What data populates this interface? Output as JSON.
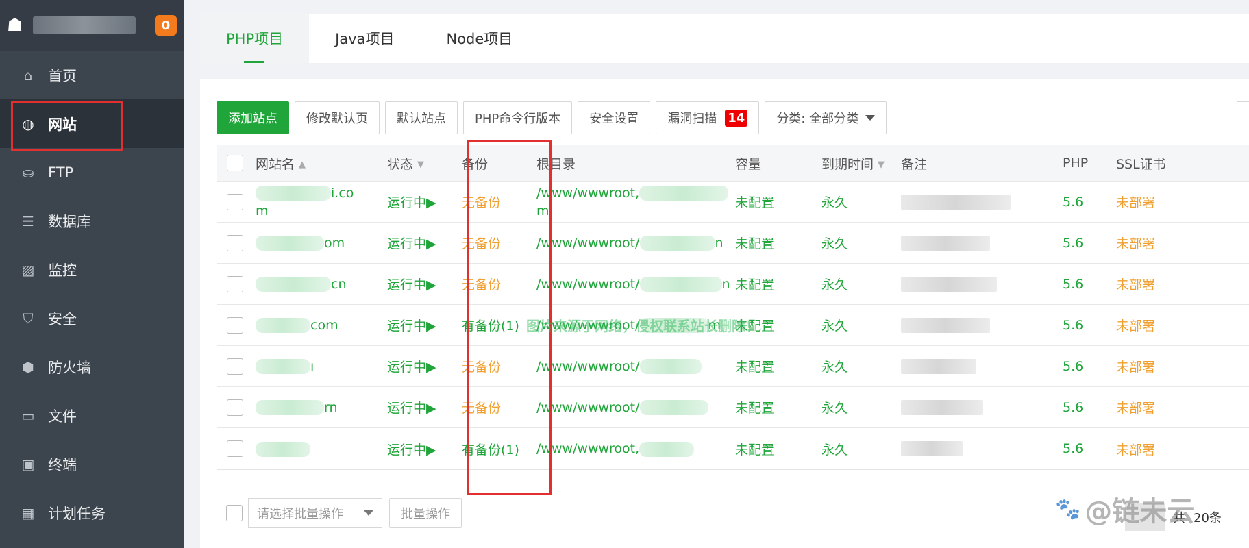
{
  "sidebar": {
    "badge": "0",
    "items": [
      {
        "icon": "home-icon",
        "glyph": "⌂",
        "label": "首页",
        "active": false
      },
      {
        "icon": "globe-icon",
        "glyph": "◍",
        "label": "网站",
        "active": true
      },
      {
        "icon": "ftp-icon",
        "glyph": "⛀",
        "label": "FTP",
        "active": false
      },
      {
        "icon": "database-icon",
        "glyph": "☰",
        "label": "数据库",
        "active": false
      },
      {
        "icon": "monitor-icon",
        "glyph": "▨",
        "label": "监控",
        "active": false
      },
      {
        "icon": "shield-icon",
        "glyph": "⛉",
        "label": "安全",
        "active": false
      },
      {
        "icon": "firewall-icon",
        "glyph": "⬢",
        "label": "防火墙",
        "active": false
      },
      {
        "icon": "folder-icon",
        "glyph": "▭",
        "label": "文件",
        "active": false
      },
      {
        "icon": "terminal-icon",
        "glyph": "▣",
        "label": "终端",
        "active": false
      },
      {
        "icon": "calendar-icon",
        "glyph": "▦",
        "label": "计划任务",
        "active": false
      }
    ]
  },
  "tabs": [
    "PHP项目",
    "Java项目",
    "Node项目"
  ],
  "toolbar": {
    "add_site": "添加站点",
    "edit_default_page": "修改默认页",
    "default_site": "默认站点",
    "php_cli_version": "PHP命令行版本",
    "security_settings": "安全设置",
    "vuln_scan": "漏洞扫描",
    "vuln_count": "14",
    "category": "分类: 全部分类"
  },
  "table": {
    "headers": {
      "name": "网站名",
      "status": "状态",
      "backup": "备份",
      "root": "根目录",
      "capacity": "容量",
      "expire": "到期时间",
      "note": "备注",
      "php": "PHP",
      "ssl": "SSL证书"
    },
    "rows": [
      {
        "name_tail": "i.co",
        "name_line2": "m",
        "status": "运行中▶",
        "backup": "无备份",
        "has_backup": false,
        "root": "/www/wwwroot,",
        "root_line2": "m",
        "capacity": "未配置",
        "expire": "永久",
        "php": "5.6",
        "ssl": "未部署"
      },
      {
        "name_tail": "om",
        "name_line2": "",
        "status": "运行中▶",
        "backup": "无备份",
        "has_backup": false,
        "root": "/www/wwwroot/",
        "root_tail": "n",
        "capacity": "未配置",
        "expire": "永久",
        "php": "5.6",
        "ssl": "未部署"
      },
      {
        "name_tail": "cn",
        "name_line2": "",
        "status": "运行中▶",
        "backup": "无备份",
        "has_backup": false,
        "root": "/www/wwwroot/",
        "root_tail": "n",
        "capacity": "未配置",
        "expire": "永久",
        "php": "5.6",
        "ssl": "未部署"
      },
      {
        "name_tail": "com",
        "name_line2": "",
        "status": "运行中▶",
        "backup": "有备份(1)",
        "has_backup": true,
        "root": "/www/wwwroot/",
        "root_tail": "m",
        "capacity": "未配置",
        "expire": "永久",
        "php": "5.6",
        "ssl": "未部署"
      },
      {
        "name_tail": "ı",
        "name_line2": "",
        "status": "运行中▶",
        "backup": "无备份",
        "has_backup": false,
        "root": "/www/wwwroot/",
        "root_tail": "",
        "capacity": "未配置",
        "expire": "永久",
        "php": "5.6",
        "ssl": "未部署"
      },
      {
        "name_tail": "rn",
        "name_line2": "",
        "status": "运行中▶",
        "backup": "无备份",
        "has_backup": false,
        "root": "/www/wwwroot/",
        "root_tail": "",
        "capacity": "未配置",
        "expire": "永久",
        "php": "5.6",
        "ssl": "未部署"
      },
      {
        "name_tail": "",
        "name_line2": "",
        "status": "运行中▶",
        "backup": "有备份(1)",
        "has_backup": true,
        "root": "/www/wwwroot,",
        "root_tail": "",
        "capacity": "未配置",
        "expire": "永久",
        "php": "5.6",
        "ssl": "未部署"
      }
    ]
  },
  "footer": {
    "batch_select_placeholder": "请选择批量操作",
    "batch_button": "批量操作",
    "page_text": "共",
    "per_page": "20条"
  },
  "overlays": {
    "watermark": "图片来源于网络，侵权联系站长删除！",
    "brand": "@链未云"
  },
  "colors": {
    "accent": "#20a53a",
    "warning": "#f0a030",
    "highlight": "#e22f2f",
    "sidebar_bg": "#3c444d"
  }
}
